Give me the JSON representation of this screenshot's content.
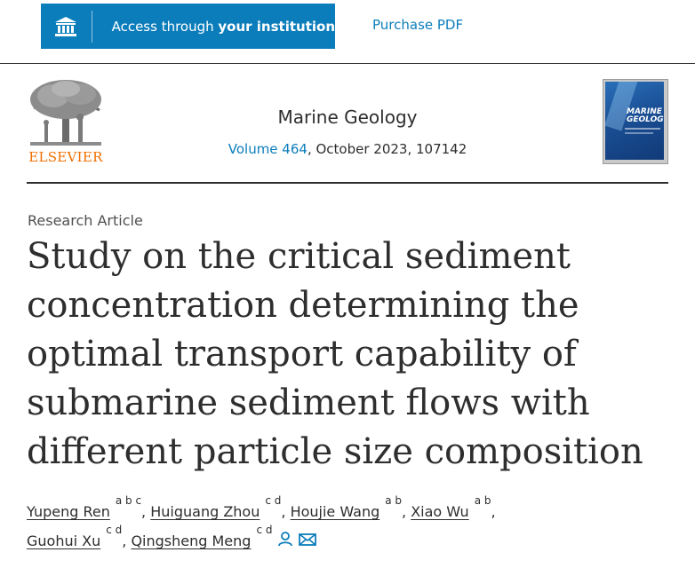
{
  "topbar": {
    "access_prefix": "Access through ",
    "access_bold": "your institution",
    "purchase_label": "Purchase PDF"
  },
  "header": {
    "publisher": "ELSEVIER",
    "journal_title": "Marine Geology",
    "volume_link": "Volume 464",
    "issue_rest": ", October 2023, 107142",
    "cover_line1": "MARINE",
    "cover_line2": "GEOLOGY"
  },
  "article": {
    "type": "Research Article",
    "title": "Study on the critical sediment concentration determining the optimal transport capability of submarine sediment flows with different particle size composition"
  },
  "authors": [
    {
      "name": "Yupeng Ren",
      "affil": "a b c",
      "sep": ", "
    },
    {
      "name": "Huiguang Zhou",
      "affil": "c d",
      "sep": ", "
    },
    {
      "name": "Houjie Wang",
      "affil": "a b",
      "sep": ", "
    },
    {
      "name": "Xiao Wu",
      "affil": "a b",
      "sep": ","
    },
    {
      "name": "Guohui Xu",
      "affil": "c d",
      "sep": ", "
    },
    {
      "name": "Qingsheng Meng",
      "affil": "c d",
      "sep": ""
    }
  ],
  "icons": {
    "institution": "institution-icon",
    "corresponding_author": "person-icon",
    "email": "envelope-icon"
  },
  "colors": {
    "link_blue": "#0c7dbb",
    "elsevier_orange": "#f06e00",
    "text": "#2e2e2e"
  }
}
